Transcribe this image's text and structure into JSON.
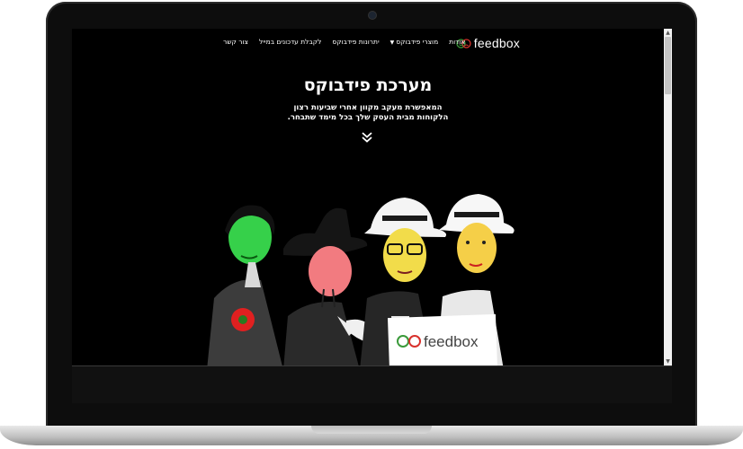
{
  "site": {
    "logo_text": "feedbox",
    "nav": [
      "אודות",
      "מוצרי פידבוקס",
      "יתרונות פידבוקס",
      "לקבלת עדכונים במייל",
      "צור קשר"
    ],
    "hero_title": "מערכת פידבוקס",
    "hero_subtitle_line1": "המאפשרת מעקב מקוון אחרי שביעות רצון",
    "hero_subtitle_line2": "הלקוחות מבית העסק שלך בכל מימד שתבחר.",
    "sign_text": "feedbox"
  },
  "colors": {
    "brand_green": "#3a9a3a",
    "brand_red": "#d8312c",
    "background": "#000000"
  },
  "icons": {
    "scroll_down": "double-chevron-down-icon",
    "logo": "smiley-faces-icon"
  }
}
